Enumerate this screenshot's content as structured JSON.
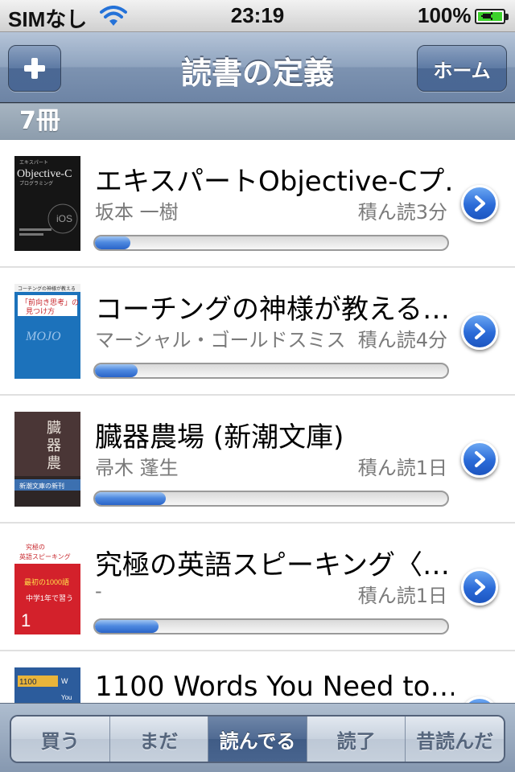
{
  "status_bar": {
    "carrier": "SIMなし",
    "time": "23:19",
    "battery_percent": "100%",
    "icons": [
      "wifi-icon",
      "battery-icon",
      "charging-plug-icon"
    ]
  },
  "nav": {
    "title": "読書の定義",
    "add_icon": "plus-icon",
    "home_label": "ホーム"
  },
  "section": {
    "count_label": "7冊"
  },
  "books": [
    {
      "title": "エキスパートObjective-Cプ…",
      "author": "坂本 一樹",
      "status": "積ん読3分",
      "progress": 0.1,
      "cover_color": "#141414"
    },
    {
      "title": "コーチングの神様が教える…",
      "author": "マーシャル・ゴールドスミス",
      "status": "積ん読4分",
      "progress": 0.12,
      "cover_color": "#1a6fb8"
    },
    {
      "title": "臓器農場 (新潮文庫)",
      "author": "帚木 蓬生",
      "status": "積ん読1日",
      "progress": 0.2,
      "cover_color": "#3a3030"
    },
    {
      "title": "究極の英語スピーキング〈…",
      "author": "-",
      "status": "積ん読1日",
      "progress": 0.18,
      "cover_color": "#d3212b"
    },
    {
      "title": "1100 Words You Need to…",
      "author": "",
      "status": "",
      "progress": 0.0,
      "cover_color": "#2c5c9c"
    }
  ],
  "tabs": [
    {
      "label": "買う",
      "active": false
    },
    {
      "label": "まだ",
      "active": false
    },
    {
      "label": "読んでる",
      "active": true
    },
    {
      "label": "読了",
      "active": false
    },
    {
      "label": "昔読んだ",
      "active": false
    }
  ],
  "colors": {
    "nav_bar": "#7d93b1",
    "accent_blue": "#2b6bd8",
    "section_header": "#9aa9b8"
  }
}
